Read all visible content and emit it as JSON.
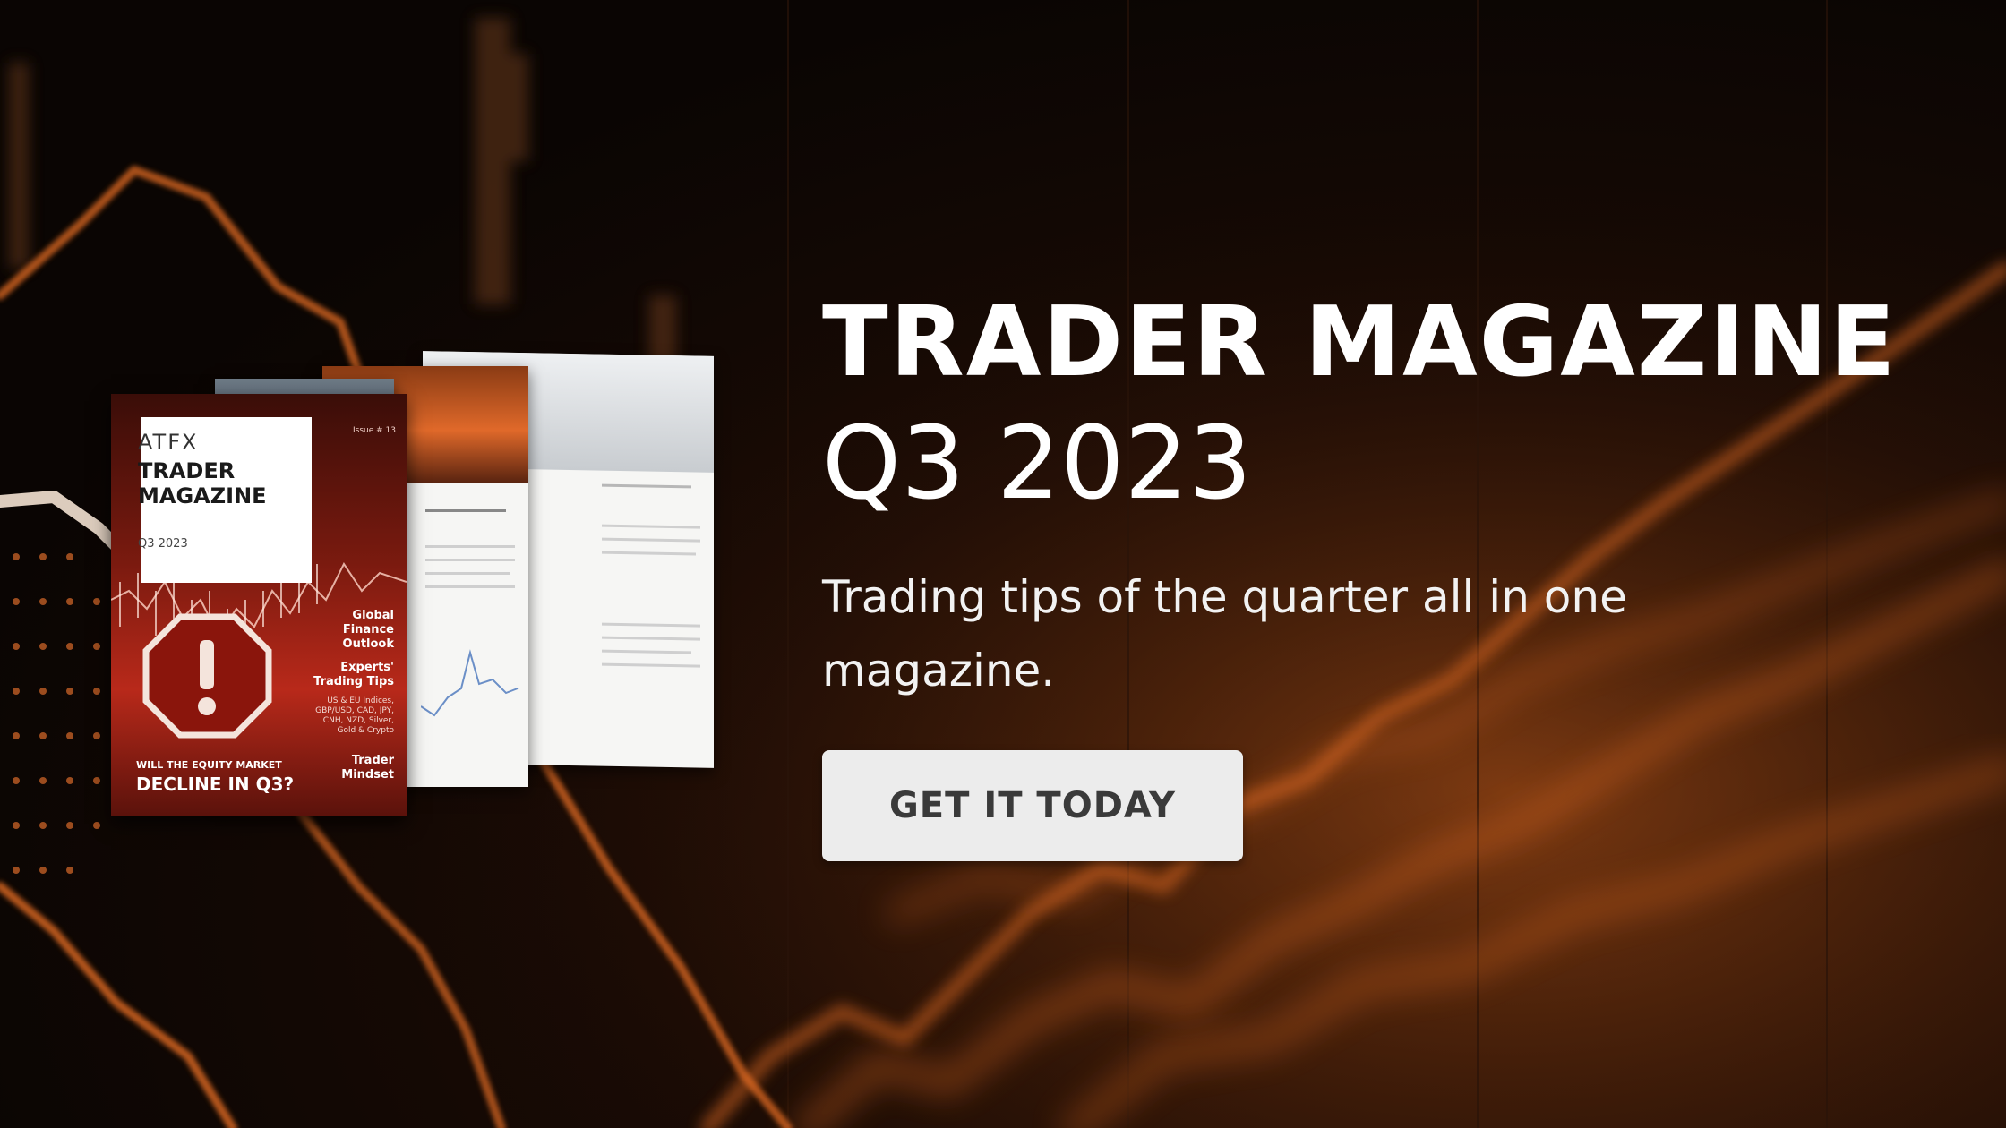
{
  "banner": {
    "title_line1": "TRADER MAGAZINE",
    "title_line2": "Q3 2023",
    "tagline": "Trading tips of the quarter all in one magazine.",
    "cta_label": "GET IT TODAY"
  },
  "magazine": {
    "brand": "ATFX",
    "title": "TRADER MAGAZINE",
    "issue_label": "Q3 2023",
    "issue_number": "Issue # 13",
    "side_items": [
      "Global Finance Outlook",
      "Experts' Trading Tips",
      "Trader Mindset"
    ],
    "side_small": "US & EU Indices, GBP/USD, CAD, JPY, CNH, NZD, Silver, Gold & Crypto",
    "headline_top": "WILL THE EQUITY MARKET",
    "headline_bottom": "DECLINE IN Q3?",
    "warning_icon": "warning-icon"
  },
  "colors": {
    "background": "#0b0604",
    "accent_orange": "#e87a2a",
    "button_bg": "#ececec",
    "button_text": "#3a3a3a",
    "title_text": "#ffffff"
  }
}
